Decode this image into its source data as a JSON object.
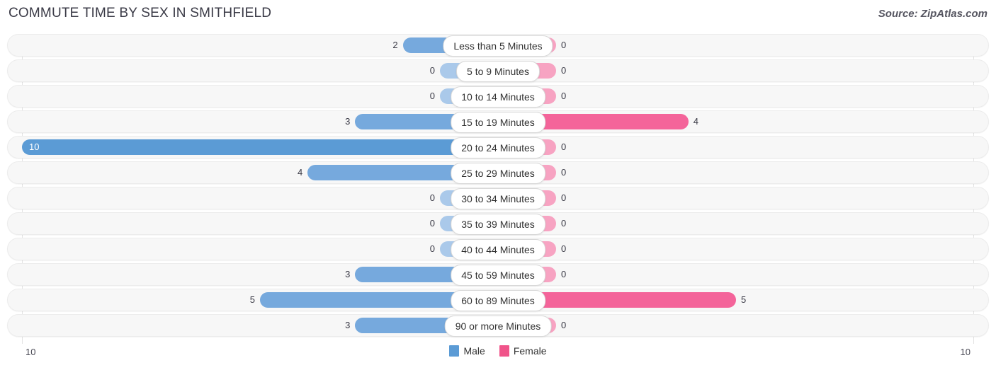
{
  "header": {
    "title": "COMMUTE TIME BY SEX IN SMITHFIELD",
    "source": "Source: ZipAtlas.com"
  },
  "legend": {
    "male_label": "Male",
    "female_label": "Female",
    "male_color": "#5b9bd5",
    "female_color": "#f0548a"
  },
  "axis": {
    "left_label": "10",
    "right_label": "10"
  },
  "chart_data": {
    "type": "bar",
    "title": "COMMUTE TIME BY SEX IN SMITHFIELD",
    "subtitle": "Source: ZipAtlas.com",
    "orientation": "horizontal-diverging",
    "xlabel": "",
    "ylabel": "",
    "xlim": [
      10,
      10
    ],
    "grid": true,
    "legend_position": "bottom-center",
    "categories": [
      "Less than 5 Minutes",
      "5 to 9 Minutes",
      "10 to 14 Minutes",
      "15 to 19 Minutes",
      "20 to 24 Minutes",
      "25 to 29 Minutes",
      "30 to 34 Minutes",
      "35 to 39 Minutes",
      "40 to 44 Minutes",
      "45 to 59 Minutes",
      "60 to 89 Minutes",
      "90 or more Minutes"
    ],
    "series": [
      {
        "name": "Male",
        "values": [
          2,
          0,
          0,
          3,
          10,
          4,
          0,
          0,
          0,
          3,
          5,
          3
        ]
      },
      {
        "name": "Female",
        "values": [
          0,
          0,
          0,
          4,
          0,
          0,
          0,
          0,
          0,
          0,
          5,
          0
        ]
      }
    ]
  },
  "rows": [
    {
      "label": "Less than 5 Minutes",
      "male": "2",
      "female": "0"
    },
    {
      "label": "5 to 9 Minutes",
      "male": "0",
      "female": "0"
    },
    {
      "label": "10 to 14 Minutes",
      "male": "0",
      "female": "0"
    },
    {
      "label": "15 to 19 Minutes",
      "male": "3",
      "female": "4"
    },
    {
      "label": "20 to 24 Minutes",
      "male": "10",
      "female": "0"
    },
    {
      "label": "25 to 29 Minutes",
      "male": "4",
      "female": "0"
    },
    {
      "label": "30 to 34 Minutes",
      "male": "0",
      "female": "0"
    },
    {
      "label": "35 to 39 Minutes",
      "male": "0",
      "female": "0"
    },
    {
      "label": "40 to 44 Minutes",
      "male": "0",
      "female": "0"
    },
    {
      "label": "45 to 59 Minutes",
      "male": "3",
      "female": "0"
    },
    {
      "label": "60 to 89 Minutes",
      "male": "5",
      "female": "5"
    },
    {
      "label": "90 or more Minutes",
      "male": "3",
      "female": "0"
    }
  ]
}
